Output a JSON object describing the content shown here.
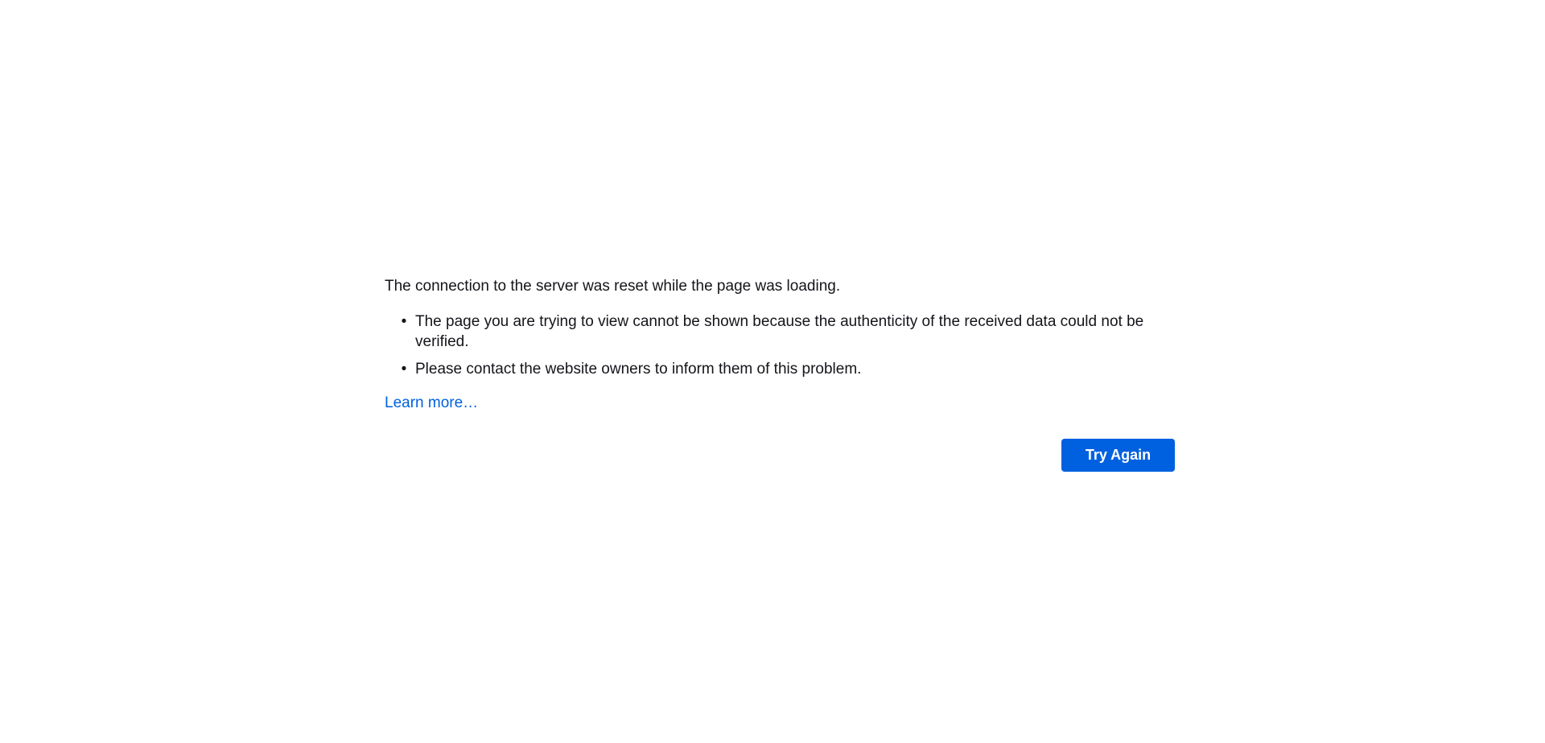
{
  "error": {
    "long_desc": "The connection to the server was reset while the page was loading.",
    "reasons": [
      "The page you are trying to view cannot be shown because the authenticity of the received data could not be verified.",
      "Please contact the website owners to inform them of this problem."
    ],
    "learn_more_label": "Learn more…",
    "try_again_label": "Try Again"
  },
  "colors": {
    "accent": "#0061e0",
    "text": "#15141a",
    "background": "#ffffff"
  }
}
